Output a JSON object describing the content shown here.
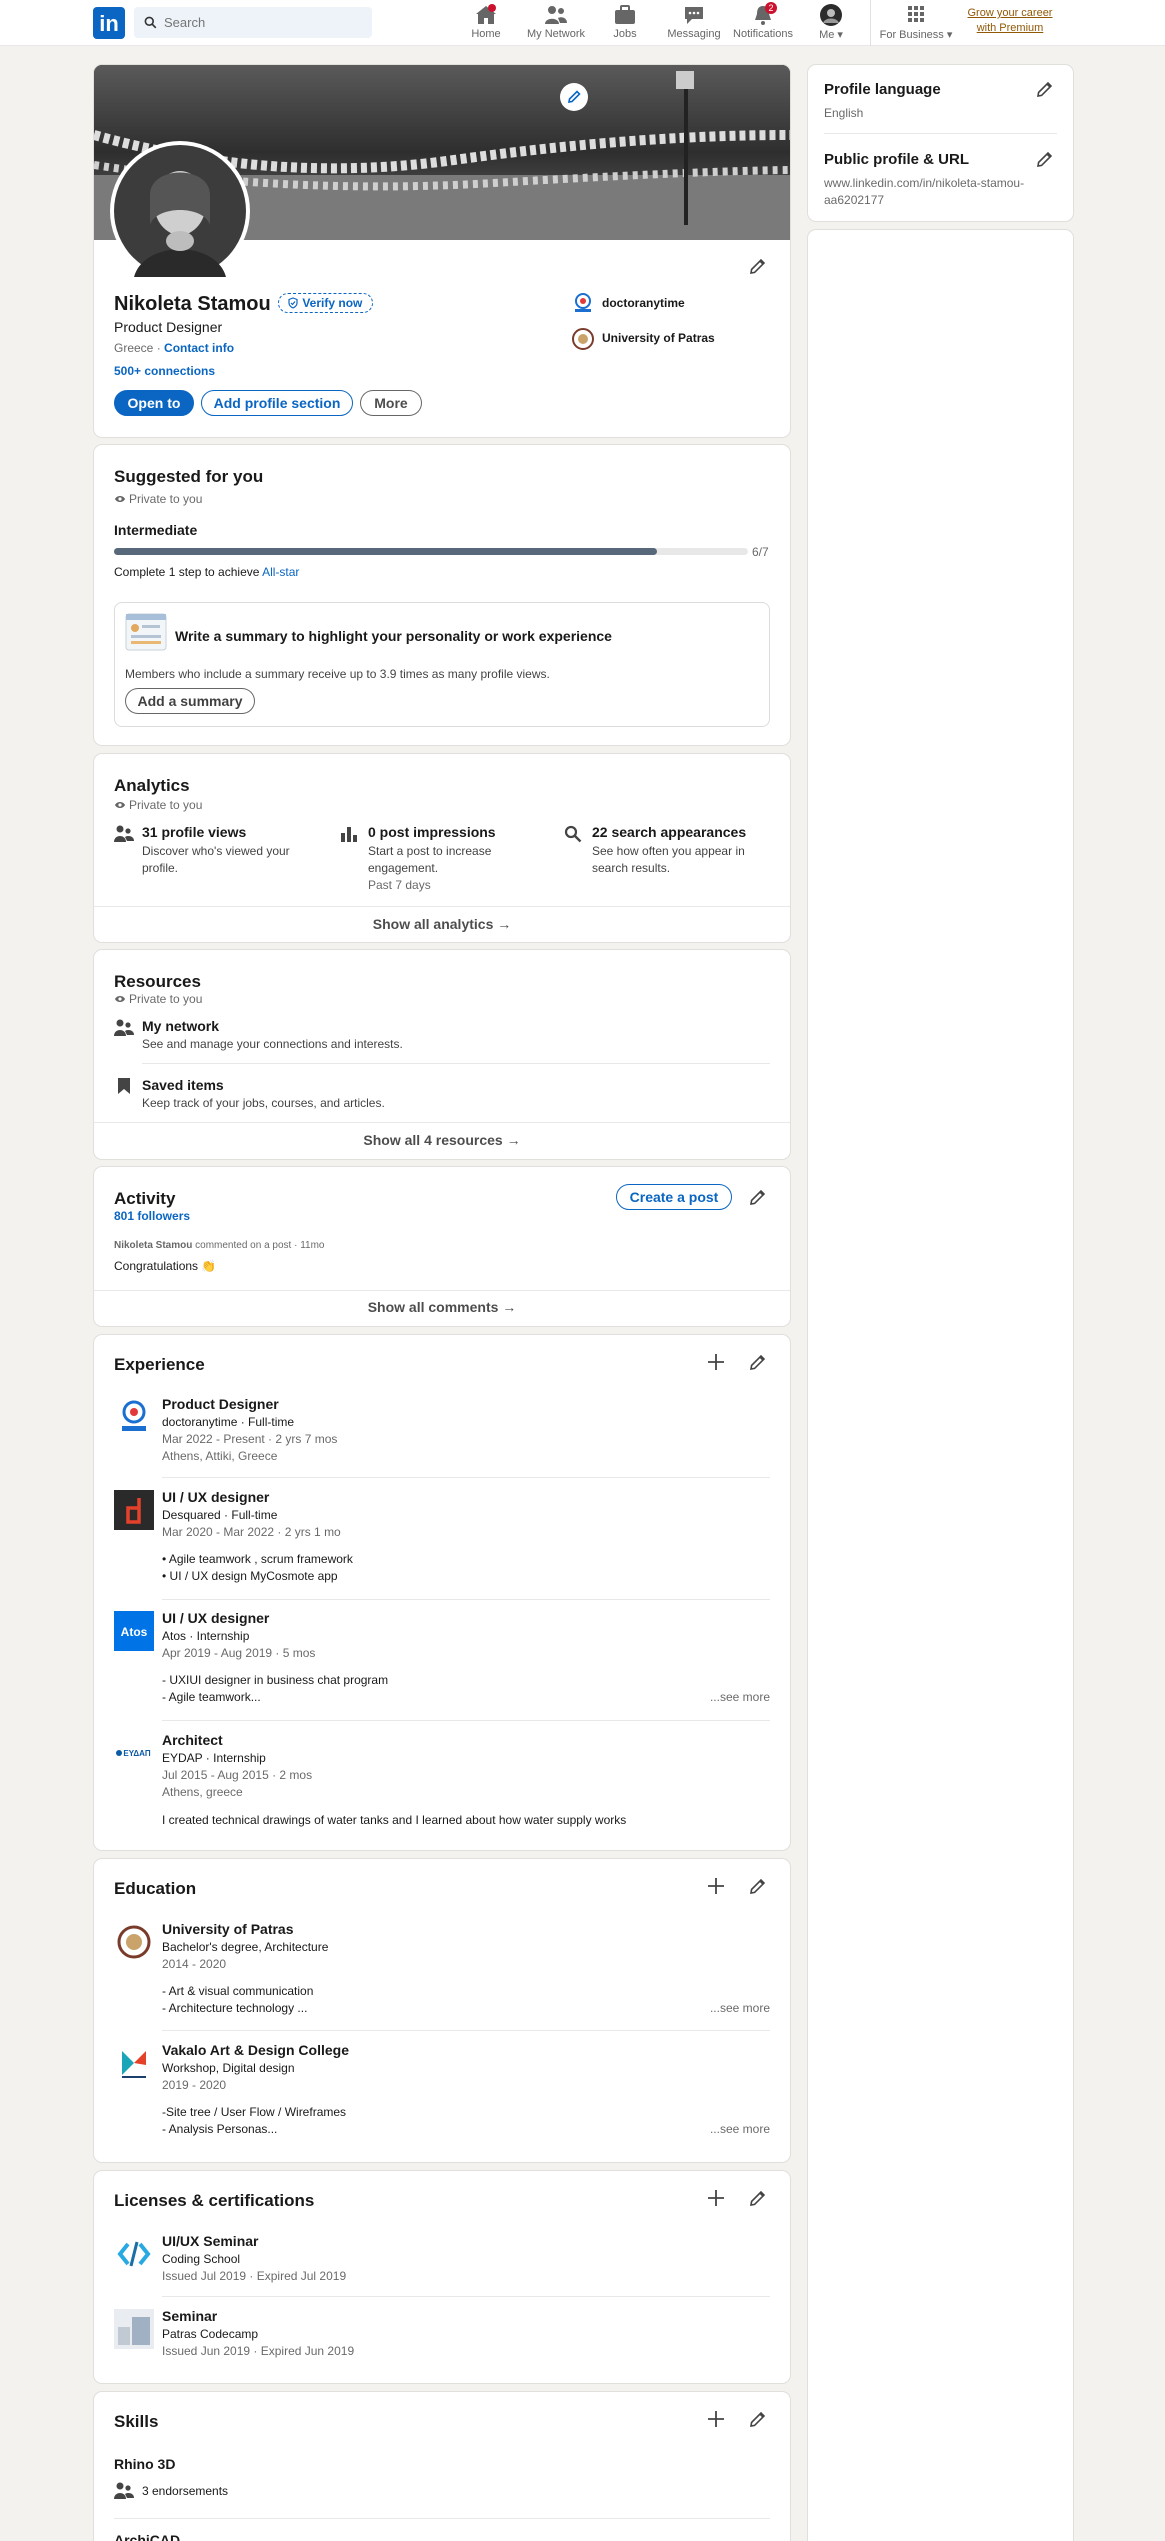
{
  "nav": {
    "logo": "in",
    "search_placeholder": "Search",
    "items": [
      {
        "label": "Home"
      },
      {
        "label": "My Network"
      },
      {
        "label": "Jobs"
      },
      {
        "label": "Messaging"
      },
      {
        "label": "Notifications",
        "badge": "2"
      },
      {
        "label": "Me"
      },
      {
        "label": "For Business"
      }
    ],
    "premium": "Grow your career with Premium"
  },
  "profile": {
    "name": "Nikoleta Stamou",
    "verify": "Verify now",
    "headline": "Product Designer",
    "location": "Greece",
    "contact": "Contact info",
    "connections": "500+ connections",
    "company": "doctoranytime",
    "school": "University of Patras",
    "buttons": {
      "open_to": "Open to",
      "add_section": "Add profile section",
      "more": "More"
    }
  },
  "suggested": {
    "title": "Suggested for you",
    "private": "Private to you",
    "level": "Intermediate",
    "progress": 6,
    "progress_total": 7,
    "progress_label": "6/7",
    "complete_prefix": "Complete 1 step to achieve",
    "complete_link": "All-star",
    "card_title": "Write a summary to highlight your personality or work experience",
    "card_desc": "Members who include a summary receive up to 3.9 times as many profile views.",
    "card_button": "Add a summary"
  },
  "analytics": {
    "title": "Analytics",
    "private": "Private to you",
    "items": [
      {
        "title": "31 profile views",
        "desc1": "Discover who's viewed your",
        "desc2": "profile.",
        "extra": ""
      },
      {
        "title": "0 post impressions",
        "desc1": "Start a post to increase",
        "desc2": "engagement.",
        "extra": "Past 7 days"
      },
      {
        "title": "22 search appearances",
        "desc1": "See how often you appear in",
        "desc2": "search results.",
        "extra": ""
      }
    ],
    "show_all": "Show all analytics →"
  },
  "resources": {
    "title": "Resources",
    "private": "Private to you",
    "items": [
      {
        "title": "My network",
        "desc": "See and manage your connections and interests."
      },
      {
        "title": "Saved items",
        "desc": "Keep track of your jobs, courses, and articles."
      }
    ],
    "show_all": "Show all 4 resources →"
  },
  "activity": {
    "title": "Activity",
    "followers": "801 followers",
    "create_post": "Create a post",
    "post_author": "Nikoleta Stamou",
    "post_meta": " commented on a post · 11mo",
    "post_text": "Congratulations 👏",
    "show_all": "Show all comments →"
  },
  "experience": {
    "title": "Experience",
    "items": [
      {
        "role": "Product Designer",
        "company": "doctoranytime · Full-time",
        "dates": "Mar 2022 - Present · 2 yrs 7 mos",
        "location": "Athens, Attiki, Greece",
        "d1": "",
        "d2": "",
        "see_more": ""
      },
      {
        "role": "UI / UX designer",
        "company": "Desquared · Full-time",
        "dates": "Mar 2020 - Mar 2022 · 2 yrs 1 mo",
        "location": "",
        "d1": "• Agile teamwork , scrum framework",
        "d2": "• UI / UX design MyCosmote app",
        "see_more": ""
      },
      {
        "role": "UI / UX designer",
        "company": "Atos · Internship",
        "dates": "Apr 2019 - Aug 2019 · 5 mos",
        "location": "",
        "d1": "- UXIUI designer in business chat program",
        "d2": "- Agile teamwork...",
        "see_more": "...see more"
      },
      {
        "role": "Architect",
        "company": "EYDAP · Internship",
        "dates": "Jul 2015 - Aug 2015 · 2 mos",
        "location": "Athens, greece",
        "d1": "I created technical drawings of water tanks and I learned about how water supply works",
        "d2": "",
        "see_more": ""
      }
    ]
  },
  "education": {
    "title": "Education",
    "items": [
      {
        "school": "University of Patras",
        "degree": "Bachelor's degree, Architecture",
        "dates": "2014 - 2020",
        "d1": "- Art & visual communication",
        "d2": "- Architecture technology ...",
        "see_more": "...see more"
      },
      {
        "school": "Vakalo Art & Design College",
        "degree": "Workshop, Digital design",
        "dates": "2019 - 2020",
        "d1": "-Site tree / User Flow / Wireframes",
        "d2": "- Analysis Personas...",
        "see_more": "...see more"
      }
    ]
  },
  "licenses": {
    "title": "Licenses & certifications",
    "items": [
      {
        "name": "UI/UX Seminar",
        "issuer": "Coding School",
        "dates": "Issued Jul 2019 · Expired Jul 2019"
      },
      {
        "name": "Seminar",
        "issuer": "Patras Codecamp",
        "dates": "Issued Jun 2019 · Expired Jun 2019"
      }
    ]
  },
  "skills": {
    "title": "Skills",
    "items": [
      {
        "name": "Rhino 3D",
        "endorsements": "3 endorsements"
      },
      {
        "name": "ArchiCAD"
      }
    ]
  },
  "sidebar": {
    "language_title": "Profile language",
    "language_value": "English",
    "url_title": "Public profile & URL",
    "url_line1": "www.linkedin.com/in/nikoleta-stamou-",
    "url_line2": "aa6202177"
  },
  "colors": {
    "brand": "#0a66c2",
    "badge": "#cb112d",
    "premium": "#915907",
    "progress": "#56687a"
  }
}
